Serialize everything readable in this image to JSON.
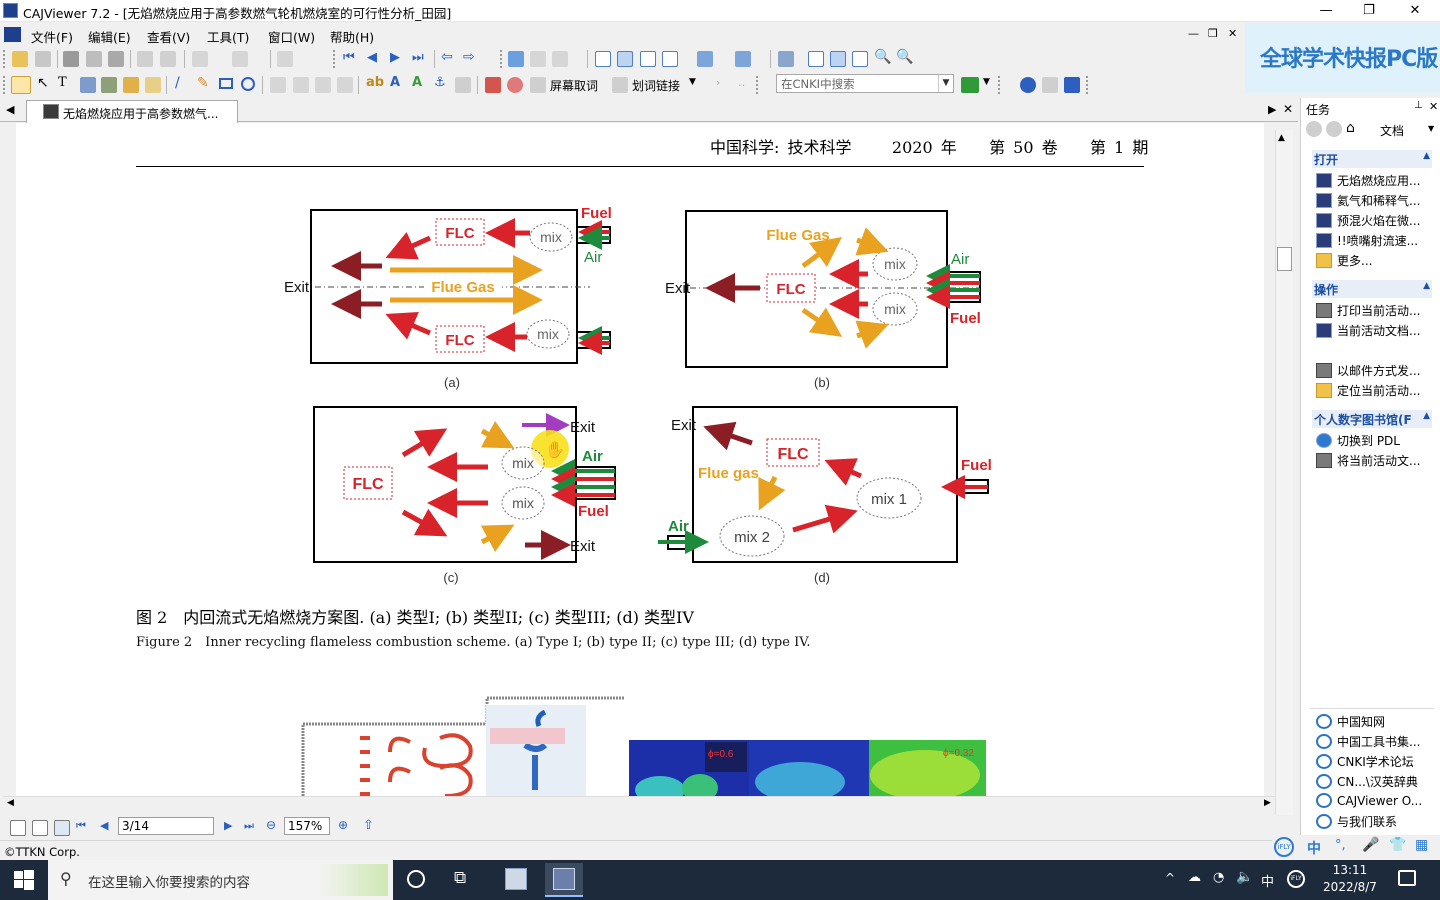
{
  "window": {
    "title": "CAJViewer 7.2 - [无焰燃烧应用于高参数燃气轮机燃烧室的可行性分析_田园]"
  },
  "menu": [
    {
      "label": "文件(F)"
    },
    {
      "label": "编辑(E)"
    },
    {
      "label": "查看(V)"
    },
    {
      "label": "工具(T)"
    },
    {
      "label": "窗口(W)"
    },
    {
      "label": "帮助(H)"
    }
  ],
  "banner": {
    "text": "全球学术快报PC版"
  },
  "toolbar": {
    "screen_word": "屏幕取词",
    "word_link": "划词链接",
    "search_placeholder": "在CNKI中搜索"
  },
  "tab": {
    "label": "无焰燃烧应用于高参数燃气..."
  },
  "document": {
    "journal": "中国科学: 技术科学",
    "year": "2020 年",
    "volume": "第 50 卷",
    "issue": "第 1 期",
    "figure": {
      "labels": {
        "exit": "Exit",
        "air": "Air",
        "fuel": "Fuel",
        "flc": "FLC",
        "mix": "mix",
        "flue_gas": "Flue Gas",
        "flue_gas_lower": "Flue gas",
        "mix1": "mix 1",
        "mix2": "mix 2"
      },
      "panels": [
        "(a)",
        "(b)",
        "(c)",
        "(d)"
      ]
    },
    "caption_cn": "图 2　内回流式无焰燃烧方案图. (a) 类型I; (b) 类型II; (c) 类型III; (d) 类型IV",
    "caption_en": "Figure 2　Inner recycling flameless combustion scheme. (a) Type I; (b) type II; (c) type III; (d) type IV.",
    "phi_labels": [
      "ϕ=0.6",
      "ϕ=0.32"
    ]
  },
  "status": {
    "page": "3/14",
    "zoom": "157%",
    "copyright": "©TTKN Corp."
  },
  "task_panel": {
    "title": "任务",
    "dropdown": "文档",
    "sections": {
      "open": "打开",
      "ops": "操作",
      "library": "个人数字图书馆(F"
    },
    "open_items": [
      "无焰燃烧应用...",
      "氦气和稀释气...",
      "预混火焰在微...",
      "!!喷嘴射流速...",
      "更多..."
    ],
    "op_items": [
      "打印当前活动...",
      "当前活动文档...",
      "以邮件方式发...",
      "定位当前活动..."
    ],
    "lib_items": [
      "切换到 PDL",
      "将当前活动文..."
    ],
    "links": [
      "中国知网",
      "中国工具书集...",
      "CNKI学术论坛",
      "CN...\\汉英辞典",
      "CAJViewer O...",
      "与我们联系"
    ]
  },
  "ime": {
    "lang": "中"
  },
  "taskbar": {
    "search": "在这里输入你要搜索的内容",
    "time": "13:11",
    "date": "2022/8/7",
    "ime": "中"
  }
}
